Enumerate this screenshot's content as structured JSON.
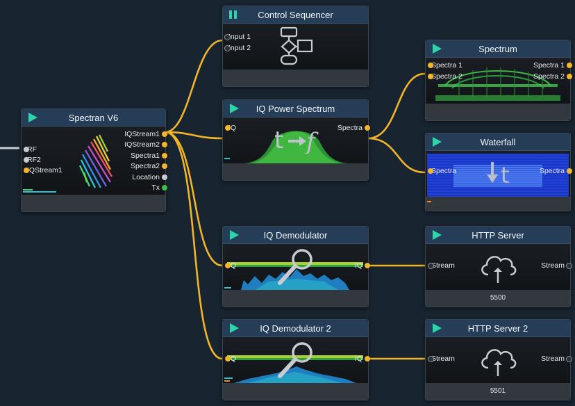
{
  "nodes": {
    "control_sequencer": {
      "title": "Control Sequencer",
      "inputs": [
        "Input 1",
        "Input 2"
      ]
    },
    "spectran": {
      "title": "Spectran V6",
      "inputs": [
        "RF",
        "RF2",
        "IQStream1"
      ],
      "outputs": [
        "IQStream1",
        "IQStream2",
        "Spectra1",
        "Spectra2",
        "Location",
        "Tx"
      ]
    },
    "iq_power_spectrum": {
      "title": "IQ Power Spectrum",
      "input": "IQ",
      "output": "Spectra"
    },
    "spectrum": {
      "title": "Spectrum",
      "inputs": [
        "Spectra 1",
        "Spectra 2"
      ],
      "outputs": [
        "Spectra 1",
        "Spectra 2"
      ]
    },
    "waterfall": {
      "title": "Waterfall",
      "input": "Spectra",
      "output": "Spectra"
    },
    "iq_demodulator": {
      "title": "IQ Demodulator",
      "input": "IQ",
      "output": "IQ"
    },
    "iq_demodulator_2": {
      "title": "IQ Demodulator 2",
      "input": "IQ",
      "output": "IQ"
    },
    "http_server": {
      "title": "HTTP Server",
      "input": "Stream",
      "output": "Stream",
      "port": "5500"
    },
    "http_server_2": {
      "title": "HTTP Server 2",
      "input": "Stream",
      "output": "Stream",
      "port": "5501"
    }
  },
  "colors": {
    "canvas": "#182430",
    "header": "#263d58",
    "wire": "#f3b62b",
    "play": "#2ad6a8"
  },
  "icons": [
    "play-icon",
    "pause-icon",
    "flowchart-icon",
    "time-to-frequency-icon",
    "magnifier-icon",
    "cloud-upload-icon",
    "down-arrow-time-icon"
  ]
}
